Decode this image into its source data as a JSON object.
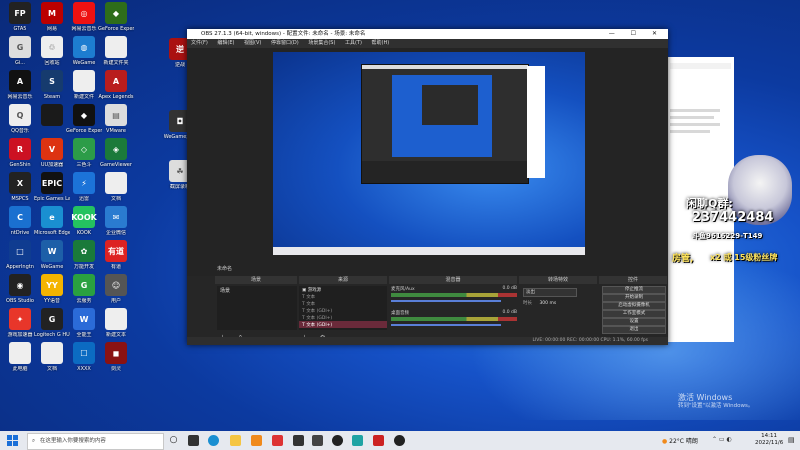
{
  "desktop": {
    "icons": [
      {
        "label": "GTA5",
        "col": "#222",
        "txt": "FP"
      },
      {
        "label": "Gi...",
        "col": "#ddd",
        "txt": "G"
      },
      {
        "label": "网易云音乐",
        "col": "#111",
        "txt": "A"
      },
      {
        "label": "QQ音乐",
        "col": "#eee",
        "txt": "Q"
      },
      {
        "label": "GenShin",
        "col": "#c12",
        "txt": "R"
      },
      {
        "label": "MSPCS",
        "col": "#222",
        "txt": "X"
      },
      {
        "label": "ntDrive",
        "col": "#1a70d0",
        "txt": "C"
      },
      {
        "label": "ApperIngtn",
        "col": "#0f3c90",
        "txt": "□"
      },
      {
        "label": "OBS Studio",
        "col": "#222",
        "txt": "◉"
      },
      {
        "label": "游戏加速器",
        "col": "#e8362a",
        "txt": "✦"
      },
      {
        "label": "此电脑",
        "col": "#eee",
        "txt": ""
      },
      {
        "label": "网易",
        "col": "#b00",
        "txt": "M"
      },
      {
        "label": "回收站",
        "col": "#eee",
        "txt": "♲"
      },
      {
        "label": "Steam",
        "col": "#163b6e",
        "txt": "S"
      },
      {
        "label": "",
        "col": "#1a1a1a",
        "txt": ""
      },
      {
        "label": "UU加速器",
        "col": "#d31",
        "txt": "V"
      },
      {
        "label": "Epic Games Launcher",
        "col": "#111",
        "txt": "EPIC"
      },
      {
        "label": "Microsoft Edge",
        "col": "#1a8fd1",
        "txt": "e"
      },
      {
        "label": "WeGame",
        "col": "#1d5fa8",
        "txt": "W"
      },
      {
        "label": "YY语音",
        "col": "#f4b400",
        "txt": "YY"
      },
      {
        "label": "Logitech G HUB",
        "col": "#222",
        "txt": "G"
      },
      {
        "label": "文档",
        "col": "#eee",
        "txt": ""
      },
      {
        "label": "网易云音乐",
        "col": "#e11",
        "txt": "◎"
      },
      {
        "label": "WeGame",
        "col": "#1d7dd0",
        "txt": "◍"
      },
      {
        "label": "新建文件",
        "col": "#eee",
        "txt": ""
      },
      {
        "label": "GeForce Experience",
        "col": "#111",
        "txt": "◆"
      },
      {
        "label": "三色斗",
        "col": "#2c9c48",
        "txt": "◇"
      },
      {
        "label": "迅雷",
        "col": "#1c73d8",
        "txt": "⚡"
      },
      {
        "label": "KOOK",
        "col": "#24c260",
        "txt": "KOOK"
      },
      {
        "label": "万能开发",
        "col": "#1a7a3a",
        "txt": "✿"
      },
      {
        "label": "云服务",
        "col": "#2aa140",
        "txt": "G"
      },
      {
        "label": "全能王",
        "col": "#2b6bd8",
        "txt": "W"
      },
      {
        "label": "XXXX",
        "col": "#0c6bc2",
        "txt": "☐"
      },
      {
        "label": "GeForce Experience",
        "col": "#2e6d1a",
        "txt": "◆"
      },
      {
        "label": "新建文件夹",
        "col": "#eee",
        "txt": ""
      },
      {
        "label": "Apex Legends",
        "col": "#b91d1d",
        "txt": "A"
      },
      {
        "label": "VMware",
        "col": "#ddd",
        "txt": "▤"
      },
      {
        "label": "GameViewer",
        "col": "#1b7a3a",
        "txt": "◈"
      },
      {
        "label": "文档",
        "col": "#eee",
        "txt": ""
      },
      {
        "label": "企业微信",
        "col": "#2a7bd0",
        "txt": "✉"
      },
      {
        "label": "有道",
        "col": "#d22",
        "txt": "有道"
      },
      {
        "label": "用户",
        "col": "#555",
        "txt": "☺"
      },
      {
        "label": "新建文本",
        "col": "#eee",
        "txt": ""
      },
      {
        "label": "剑灵",
        "col": "#8a1212",
        "txt": "◼"
      },
      {
        "label": "逆战",
        "col": "#a11",
        "txt": "逆"
      },
      {
        "label": "WeGame游戏",
        "col": "#333",
        "txt": "◘"
      },
      {
        "label": "截屏录制",
        "col": "#ddd",
        "txt": "☘"
      },
      {
        "label": "迷你世界",
        "col": "#2255aa",
        "txt": "✪"
      }
    ]
  },
  "obs": {
    "title": "OBS 27.1.3 (64-bit, windows) - 配置文件: 未命名 - 场景: 未命名",
    "window_controls": "—  ☐  ✕",
    "menu": [
      "文件(F)",
      "编辑(E)",
      "视图(V)",
      "停靠窗口(D)",
      "场景集合(S)",
      "工具(T)",
      "帮助(H)"
    ],
    "docks": {
      "scenes": "场景",
      "sources": "来源",
      "mixer": "混音器",
      "transitions": "转场特效",
      "controls": "控件"
    },
    "scene_item": "场景",
    "sources": [
      "游戏源",
      "文本",
      "文本",
      "文本 (GDI+)",
      "文本 (GDI+)",
      "文本 (GDI+)"
    ],
    "mixer_tracks": [
      {
        "name": "麦克风/Aux",
        "level": "0.0 dB"
      },
      {
        "name": "桌面音频",
        "level": "0.0 dB"
      }
    ],
    "transition": "淡出",
    "duration_label": "时长",
    "duration_value": "300 ms",
    "controls": [
      "停止推流",
      "开始录制",
      "启动虚拟摄像机",
      "工作室模式",
      "设置",
      "退出"
    ],
    "status": "LIVE: 00:00:00   REC: 00:00:00   CPU: 1.1%, 60.00 fps",
    "scene_panel_title": "未命名"
  },
  "overlay": {
    "line1": "闲聊Q群:",
    "line2": "237442484",
    "line3": "斗鱼9616229-T149",
    "line4": "房管,",
    "line5": "x2 或 15级粉丝牌"
  },
  "activation": {
    "line1": "激活 Windows",
    "line2": "转到\"设置\"以激活 Windows。"
  },
  "taskbar": {
    "search_placeholder": "在这里输入你要搜索的内容",
    "weather": "22°C 晴朗",
    "time": "14:11",
    "date": "2022/11/6"
  },
  "colors": {
    "desktop_accent": "#1652c8",
    "obs_bg": "#2b2b2b",
    "taskbar": "#e6e9ef"
  }
}
